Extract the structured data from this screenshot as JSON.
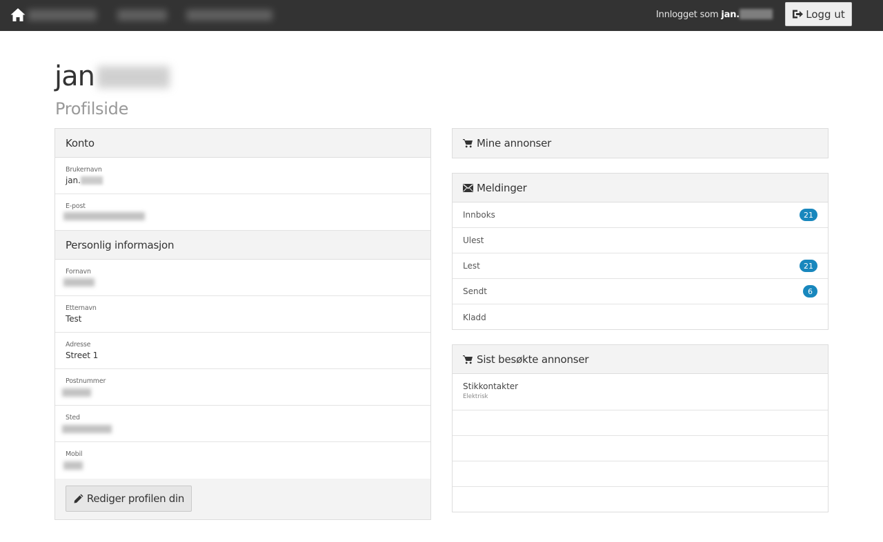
{
  "navbar": {
    "logged_in_prefix": "Innlogget som",
    "user_name": "jan.",
    "logout_label": "Logg ut",
    "home_icon": "home-icon",
    "logout_icon": "logout-icon"
  },
  "header": {
    "title": "jan",
    "subtitle": "Profilside"
  },
  "account": {
    "heading": "Konto",
    "fields": [
      {
        "label": "Brukernavn",
        "value": "jan."
      },
      {
        "label": "E-post",
        "value": ""
      }
    ]
  },
  "personal": {
    "heading": "Personlig informasjon",
    "fields": [
      {
        "label": "Fornavn",
        "value": ""
      },
      {
        "label": "Etternavn",
        "value": "Test"
      },
      {
        "label": "Adresse",
        "value": "Street 1"
      },
      {
        "label": "Postnummer",
        "value": ""
      },
      {
        "label": "Sted",
        "value": ""
      },
      {
        "label": "Mobil",
        "value": ""
      }
    ],
    "edit_button": "Rediger profilen din",
    "edit_icon": "pencil-icon"
  },
  "my_ads": {
    "heading": "Mine annonser",
    "icon": "cart-icon"
  },
  "messages": {
    "heading": "Meldinger",
    "icon": "envelope-icon",
    "items": [
      {
        "label": "Innboks",
        "count": "21"
      },
      {
        "label": "Ulest",
        "count": ""
      },
      {
        "label": "Lest",
        "count": "21"
      },
      {
        "label": "Sendt",
        "count": "6"
      },
      {
        "label": "Kladd",
        "count": ""
      }
    ]
  },
  "recent_ads": {
    "heading": "Sist besøkte annonser",
    "icon": "cart-icon",
    "items": [
      {
        "title": "Stikkontakter",
        "category": "Elektrisk"
      }
    ]
  },
  "colors": {
    "navbar": "#333333",
    "badge": "#1887bd",
    "panel_head": "#f3f3f3"
  }
}
